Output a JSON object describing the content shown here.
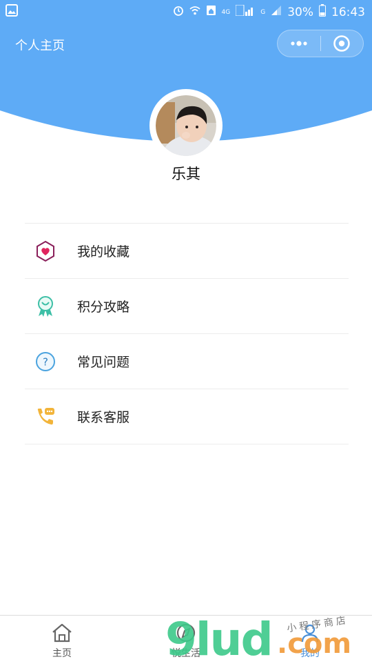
{
  "status_bar": {
    "battery": "30%",
    "time": "16:43",
    "network_label": "4G",
    "network_label_2": "G"
  },
  "header": {
    "title": "个人主页",
    "bg_color": "#5eabf6"
  },
  "profile": {
    "name": "乐其"
  },
  "menu": {
    "items": [
      {
        "label": "我的收藏",
        "icon": "favorites-heart-icon"
      },
      {
        "label": "积分攻略",
        "icon": "medal-icon"
      },
      {
        "label": "常见问题",
        "icon": "question-icon"
      },
      {
        "label": "联系客服",
        "icon": "phone-chat-icon"
      }
    ]
  },
  "tabbar": {
    "tabs": [
      {
        "label": "主页",
        "icon": "home-icon"
      },
      {
        "label": "悦生活",
        "icon": "compass-icon"
      },
      {
        "label": "我的",
        "icon": "profile-icon"
      }
    ]
  },
  "watermark": {
    "brand": "9lud",
    "domain": ".com",
    "cn_text": "小程序商店"
  }
}
